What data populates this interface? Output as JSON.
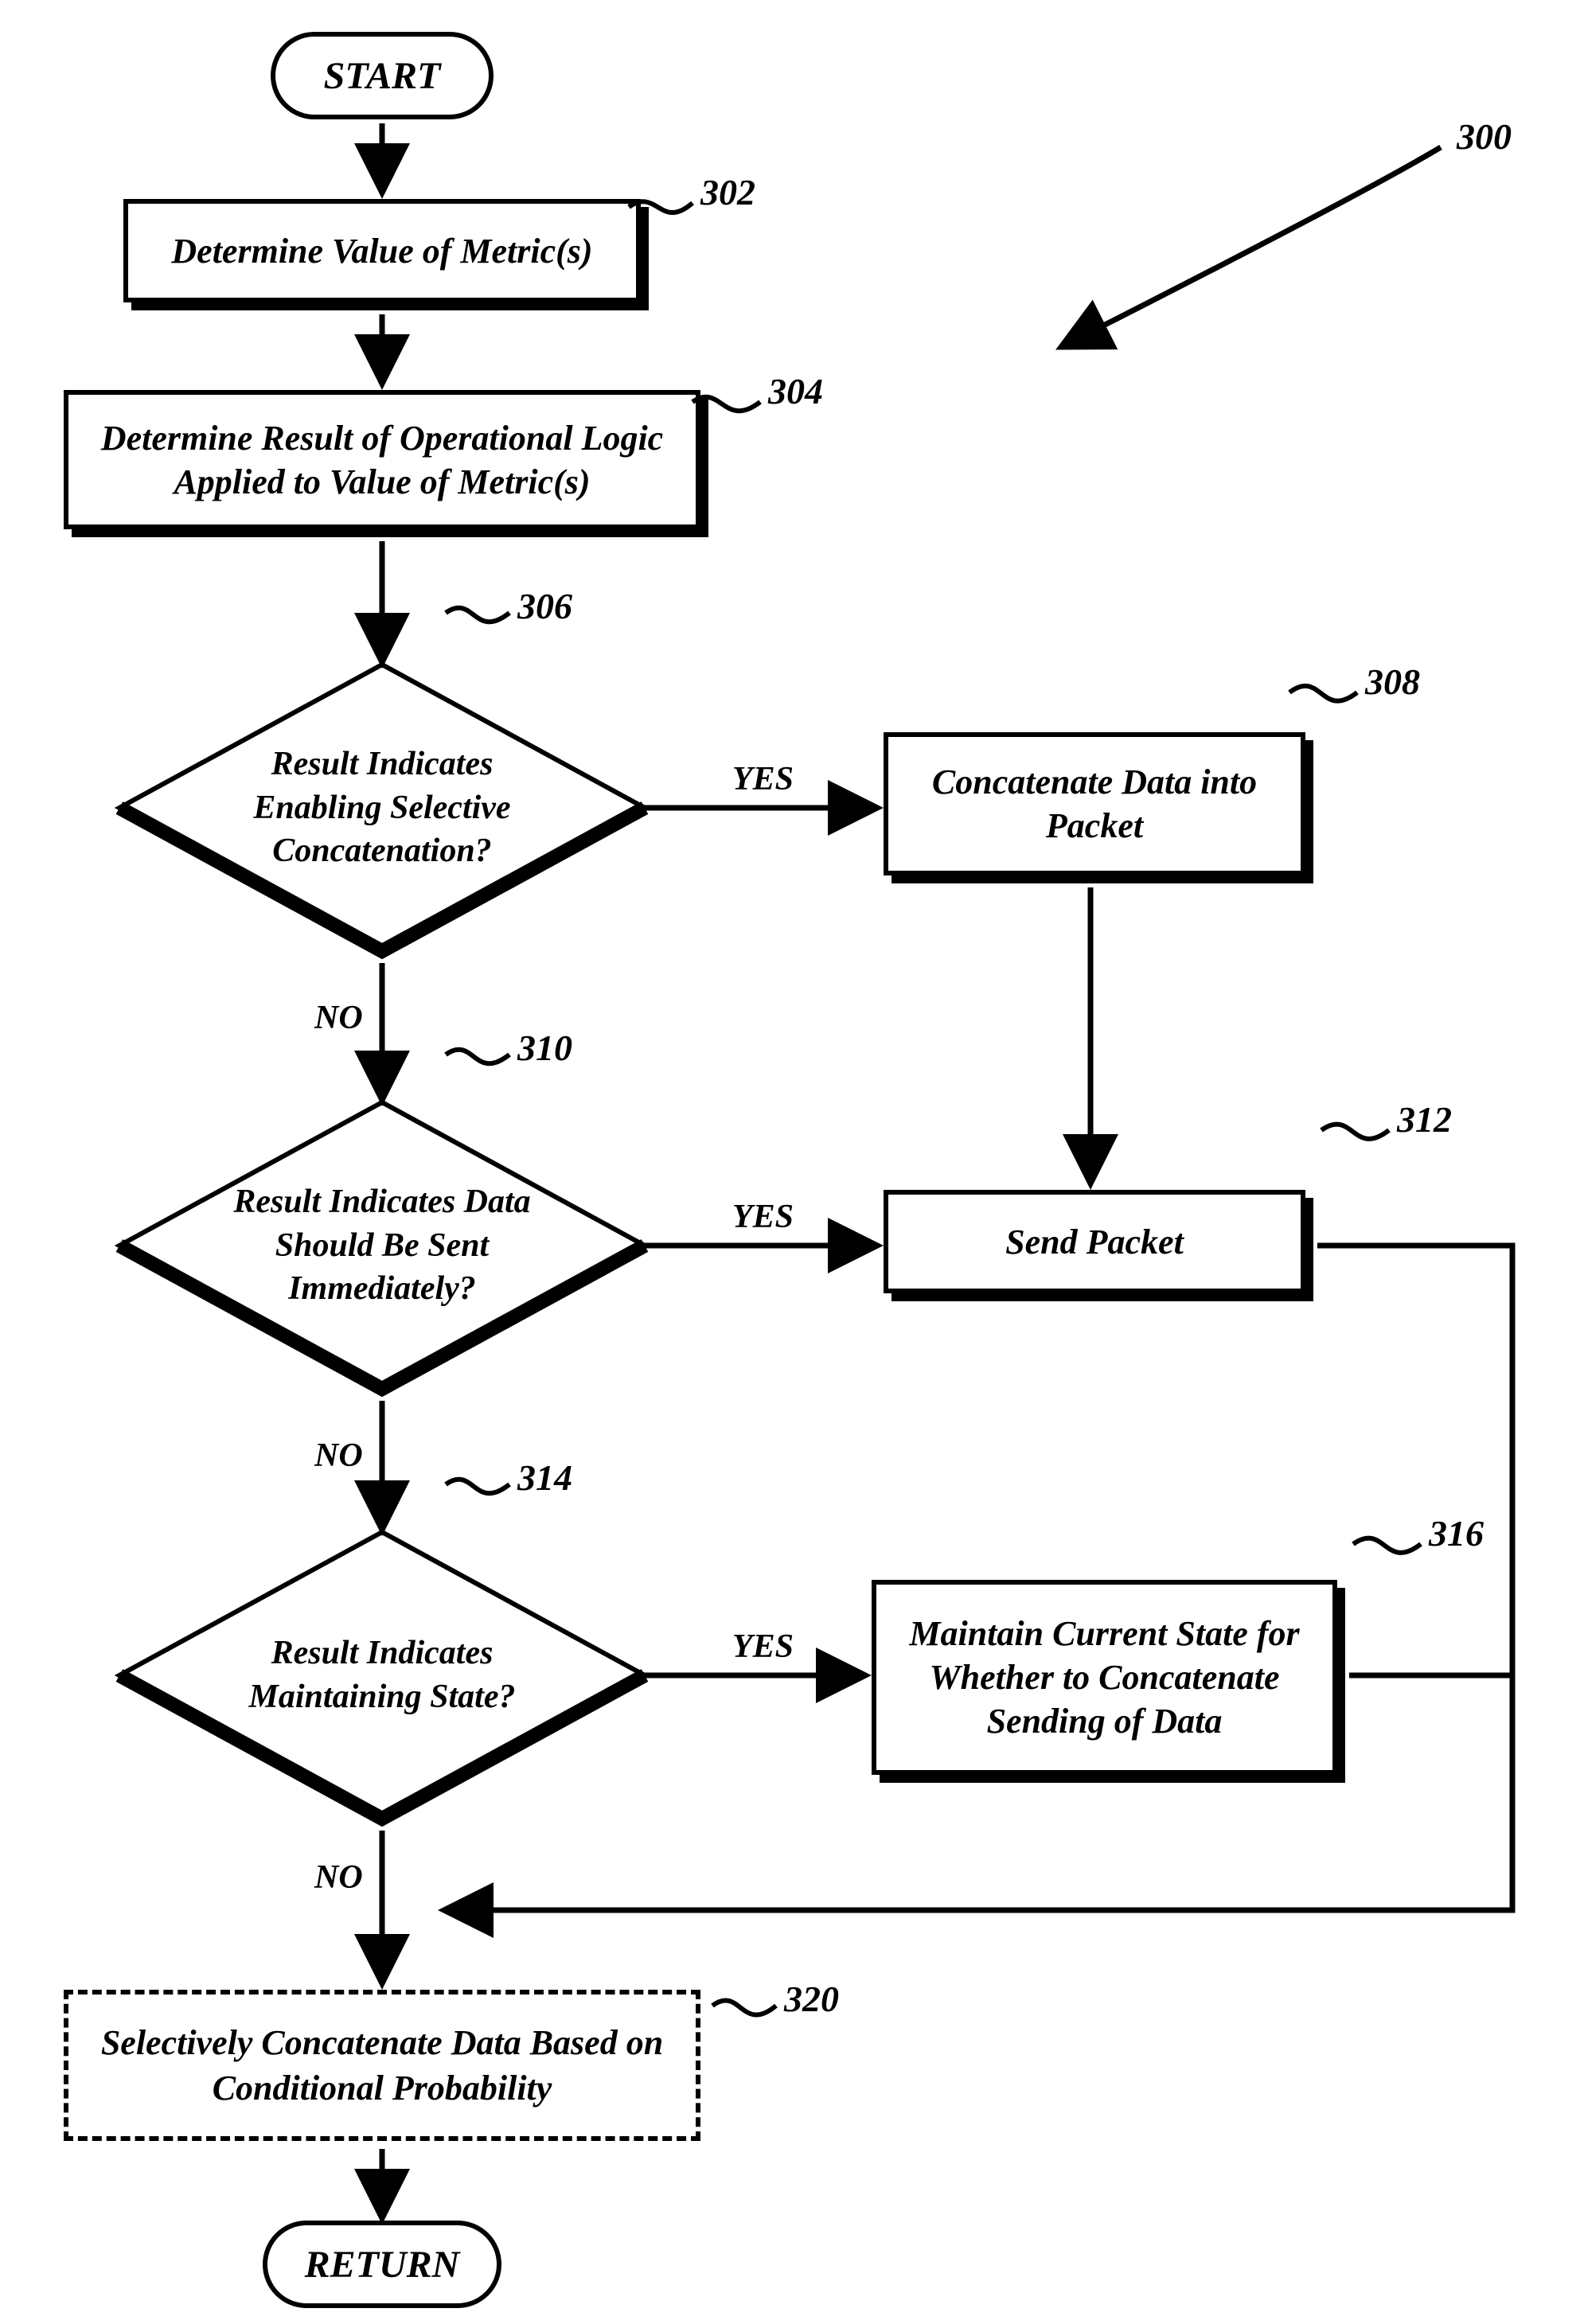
{
  "chart_data": {
    "type": "table",
    "diagram": "flowchart",
    "nodes": [
      {
        "id": "start",
        "kind": "terminator",
        "text": "START"
      },
      {
        "id": "302",
        "kind": "process",
        "text": "Determine Value of Metric(s)"
      },
      {
        "id": "304",
        "kind": "process",
        "text": "Determine Result of Operational Logic Applied to Value of Metric(s)"
      },
      {
        "id": "306",
        "kind": "decision",
        "text": "Result Indicates Enabling Selective Concatenation?"
      },
      {
        "id": "308",
        "kind": "process",
        "text": "Concatenate Data into Packet"
      },
      {
        "id": "310",
        "kind": "decision",
        "text": "Result Indicates Data Should Be Sent Immediately?"
      },
      {
        "id": "312",
        "kind": "process",
        "text": "Send Packet"
      },
      {
        "id": "314",
        "kind": "decision",
        "text": "Result Indicates Maintaining State?"
      },
      {
        "id": "316",
        "kind": "process",
        "text": "Maintain Current State for Whether to Concatenate Sending of Data"
      },
      {
        "id": "320",
        "kind": "process_dashed",
        "text": "Selectively Concatenate Data Based on Conditional Probability"
      },
      {
        "id": "return",
        "kind": "terminator",
        "text": "RETURN"
      }
    ],
    "edges": [
      {
        "from": "start",
        "to": "302"
      },
      {
        "from": "302",
        "to": "304"
      },
      {
        "from": "304",
        "to": "306"
      },
      {
        "from": "306",
        "to": "308",
        "label": "YES"
      },
      {
        "from": "306",
        "to": "310",
        "label": "NO"
      },
      {
        "from": "308",
        "to": "312"
      },
      {
        "from": "310",
        "to": "312",
        "label": "YES"
      },
      {
        "from": "310",
        "to": "314",
        "label": "NO"
      },
      {
        "from": "312",
        "to": "merge_above_320"
      },
      {
        "from": "314",
        "to": "316",
        "label": "YES"
      },
      {
        "from": "314",
        "to": "320",
        "label": "NO"
      },
      {
        "from": "316",
        "to": "merge_above_320"
      },
      {
        "from": "merge_above_320",
        "to": "320"
      },
      {
        "from": "320",
        "to": "return"
      }
    ],
    "reference_numerals": [
      "300",
      "302",
      "304",
      "306",
      "308",
      "310",
      "312",
      "314",
      "316",
      "320"
    ]
  },
  "start": "START",
  "return": "RETURN",
  "n302": "Determine Value of Metric(s)",
  "n304": "Determine Result of Operational Logic Applied to Value of Metric(s)",
  "n306": "Result Indicates Enabling Selective Concatenation?",
  "n308": "Concatenate Data into Packet",
  "n310": "Result Indicates Data Should Be Sent Immediately?",
  "n312": "Send Packet",
  "n314": "Result Indicates Maintaining State?",
  "n316": "Maintain Current State for Whether to Concatenate Sending of Data",
  "n320": "Selectively Concatenate Data Based on Conditional Probability",
  "labels": {
    "yes": "YES",
    "no": "NO"
  },
  "refs": {
    "r300": "300",
    "r302": "302",
    "r304": "304",
    "r306": "306",
    "r308": "308",
    "r310": "310",
    "r312": "312",
    "r314": "314",
    "r316": "316",
    "r320": "320"
  }
}
